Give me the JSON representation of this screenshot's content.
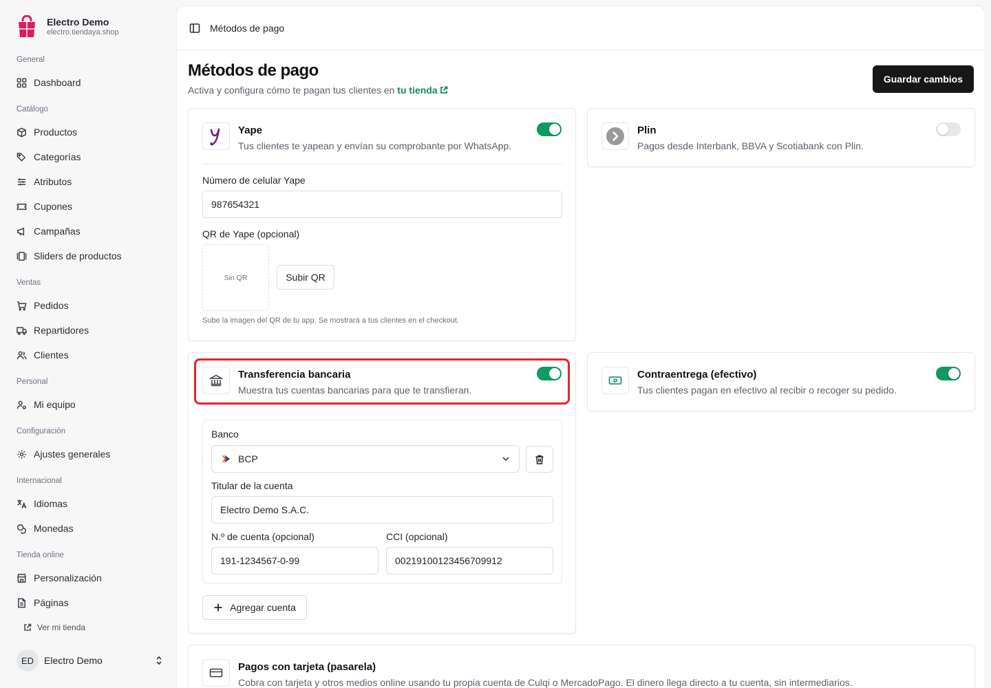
{
  "brand": {
    "name": "Electro Demo",
    "url": "electro.tiendaya.shop",
    "color": "#e6175c"
  },
  "sidebar": {
    "sections": [
      {
        "label": "General",
        "items": [
          {
            "label": "Dashboard",
            "icon": "grid-icon"
          }
        ]
      },
      {
        "label": "Catálogo",
        "items": [
          {
            "label": "Productos",
            "icon": "box-icon"
          },
          {
            "label": "Categorías",
            "icon": "tags-icon"
          },
          {
            "label": "Atributos",
            "icon": "sliders-icon"
          },
          {
            "label": "Cupones",
            "icon": "ticket-icon"
          },
          {
            "label": "Campañas",
            "icon": "megaphone-icon"
          },
          {
            "label": "Sliders de productos",
            "icon": "carousel-icon"
          }
        ]
      },
      {
        "label": "Ventas",
        "items": [
          {
            "label": "Pedidos",
            "icon": "cart-icon"
          },
          {
            "label": "Repartidores",
            "icon": "truck-icon"
          },
          {
            "label": "Clientes",
            "icon": "users-icon"
          }
        ]
      },
      {
        "label": "Personal",
        "items": [
          {
            "label": "Mi equipo",
            "icon": "user-gear-icon"
          }
        ]
      },
      {
        "label": "Configuración",
        "items": [
          {
            "label": "Ajustes generales",
            "icon": "gear-icon"
          }
        ]
      },
      {
        "label": "Internacional",
        "items": [
          {
            "label": "Idiomas",
            "icon": "translate-icon"
          },
          {
            "label": "Monedas",
            "icon": "coins-icon"
          }
        ]
      },
      {
        "label": "Tienda online",
        "items": [
          {
            "label": "Personalización",
            "icon": "store-icon"
          },
          {
            "label": "Páginas",
            "icon": "file-icon"
          }
        ]
      }
    ],
    "view_store": "Ver mi tienda",
    "user": {
      "initials": "ED",
      "name": "Electro Demo"
    }
  },
  "topbar": {
    "title": "Métodos de pago"
  },
  "page": {
    "title": "Métodos de pago",
    "subtitle": "Activa y configura cómo te pagan tus clientes en",
    "subtitle_link": "tu tienda",
    "save_label": "Guardar cambios"
  },
  "methods": {
    "yape": {
      "title": "Yape",
      "desc": "Tus clientes te yapean y envían su comprobante por WhatsApp.",
      "enabled": true,
      "phone_label": "Número de celular Yape",
      "phone_value": "987654321",
      "qr_label": "QR de Yape (opcional)",
      "qr_placeholder": "Sin QR",
      "qr_button": "Subir QR",
      "qr_hint": "Sube la imagen del QR de tu app. Se mostrará a tus clientes en el checkout."
    },
    "plin": {
      "title": "Plin",
      "desc": "Pagos desde Interbank, BBVA y Scotiabank con Plin.",
      "enabled": false
    },
    "transfer": {
      "title": "Transferencia bancaria",
      "desc": "Muestra tus cuentas bancarias para que te transfieran.",
      "enabled": true,
      "bank_label": "Banco",
      "bank_value": "BCP",
      "holder_label": "Titular de la cuenta",
      "holder_value": "Electro Demo S.A.C.",
      "account_label": "N.º de cuenta (opcional)",
      "account_value": "191-1234567-0-99",
      "cci_label": "CCI (opcional)",
      "cci_value": "00219100123456709912",
      "add_account": "Agregar cuenta"
    },
    "cod": {
      "title": "Contraentrega (efectivo)",
      "desc": "Tus clientes pagan en efectivo al recibir o recoger su pedido.",
      "enabled": true
    },
    "card": {
      "title": "Pagos con tarjeta (pasarela)",
      "desc": "Cobra con tarjeta y otros medios online usando tu propia cuenta de Culqi o MercadoPago. El dinero llega directo a tu cuenta, sin intermediarios."
    }
  },
  "colors": {
    "accent_green": "#0f9a62",
    "link_green": "#0f8a5f",
    "highlight_red": "#e0262b",
    "yape_purple": "#742284"
  }
}
